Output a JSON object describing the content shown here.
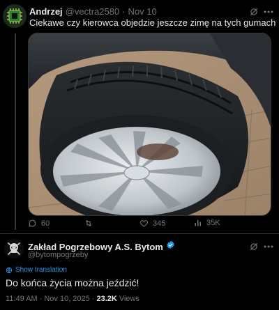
{
  "tweet": {
    "author_name": "Andrzej",
    "handle": "@vectra2580",
    "separator": "·",
    "date": "Nov 10",
    "text": "Ciekawe czy kierowca objedzie jeszcze zimę na tych gumach",
    "emoji": "🤔",
    "stats": {
      "replies": "60",
      "retweets": "",
      "likes": "345",
      "views": "35K"
    }
  },
  "reply": {
    "author_name": "Zakład Pogrzebowy A.S. Bytom",
    "handle": "@bytompogrzeby",
    "show_translation": "Show translation",
    "text": "Do końca życia można jeździć!",
    "time": "11:49 AM",
    "separator": "·",
    "date": "Nov 10, 2025",
    "views_count": "23.2K",
    "views_label": "Views"
  },
  "colors": {
    "background": "#000000",
    "text_primary": "#e7e9ea",
    "text_muted": "#71767b",
    "accent_blue": "#1d9bf0",
    "divider": "#2f3336"
  },
  "icons": [
    "avatar-chip",
    "grok-icon",
    "more-icon",
    "reply-icon",
    "retweet-icon",
    "like-icon",
    "views-icon",
    "verified-badge-icon",
    "translate-icon",
    "skull-avatar"
  ]
}
